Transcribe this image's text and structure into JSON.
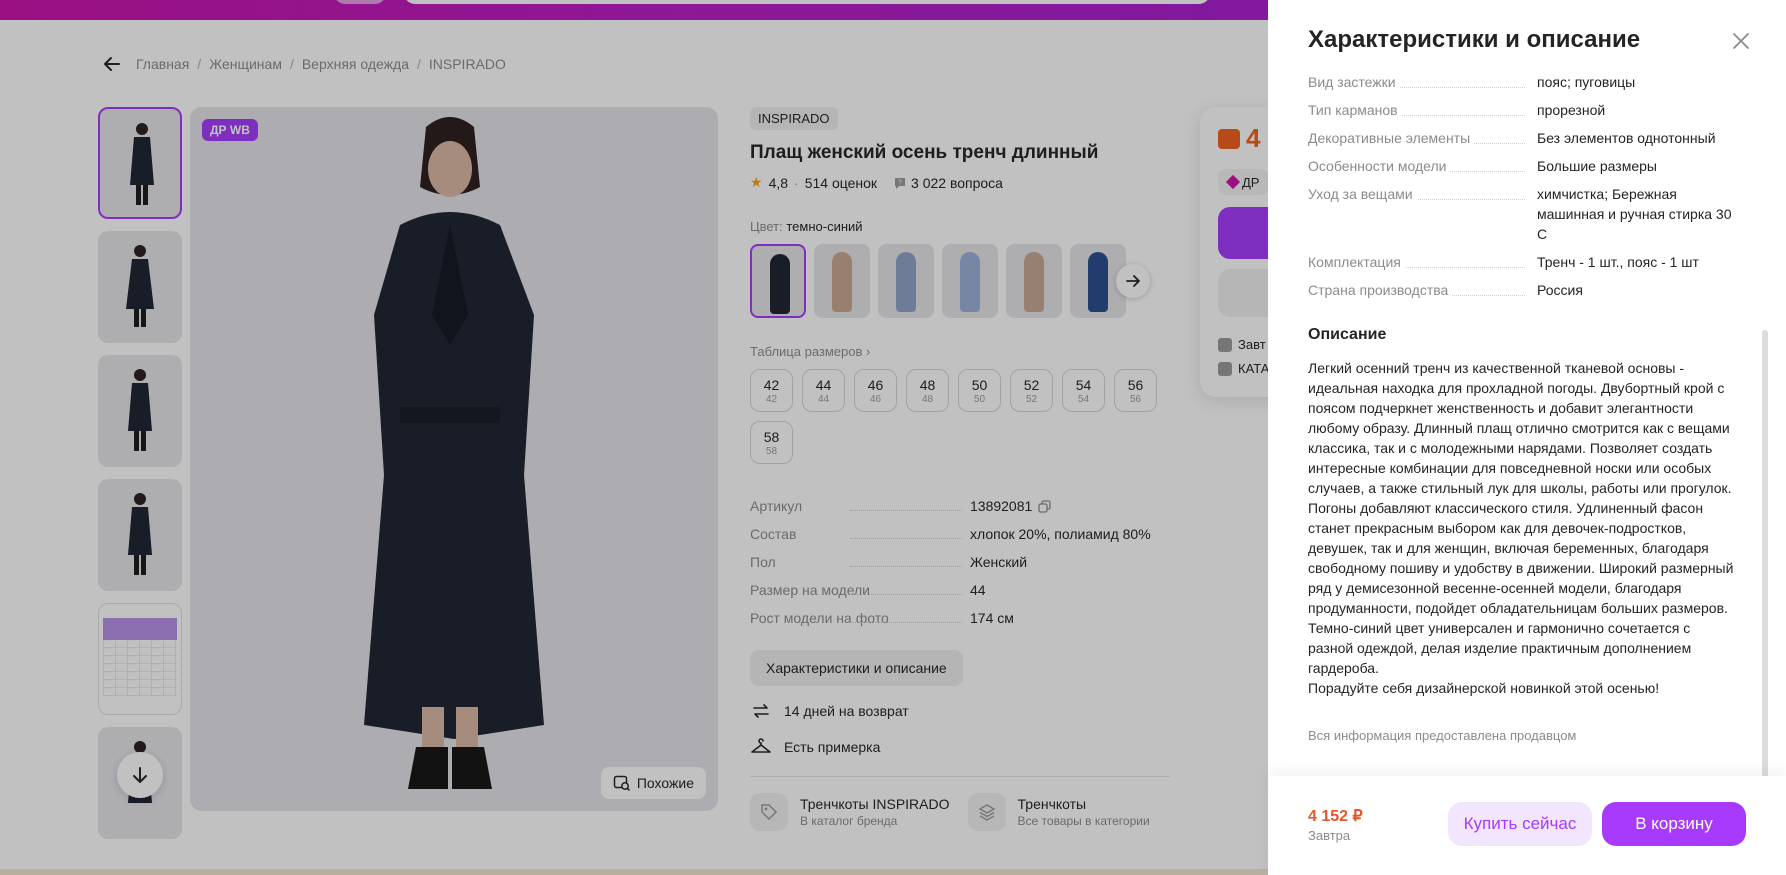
{
  "breadcrumbs": [
    "Главная",
    "Женщинам",
    "Верхняя одежда",
    "INSPIRADO"
  ],
  "gallery": {
    "badge": "ДР WB",
    "similar_label": "Похожие"
  },
  "product": {
    "brand": "INSPIRADO",
    "title": "Плащ женский осень тренч длинный",
    "rating": "4,8",
    "reviews": "514 оценок",
    "questions": "3 022 вопроса",
    "color_label": "Цвет:",
    "color_value": "темно-синий",
    "size_table_label": "Таблица размеров",
    "sizes": [
      {
        "ru": "42",
        "eu": "42"
      },
      {
        "ru": "44",
        "eu": "44"
      },
      {
        "ru": "46",
        "eu": "46"
      },
      {
        "ru": "48",
        "eu": "48"
      },
      {
        "ru": "50",
        "eu": "50"
      },
      {
        "ru": "52",
        "eu": "52"
      },
      {
        "ru": "54",
        "eu": "54"
      },
      {
        "ru": "56",
        "eu": "56"
      },
      {
        "ru": "58",
        "eu": "58"
      }
    ],
    "params": [
      {
        "k": "Артикул",
        "v": "13892081"
      },
      {
        "k": "Состав",
        "v": "хлопок 20%, полиамид 80%"
      },
      {
        "k": "Пол",
        "v": "Женский"
      },
      {
        "k": "Размер на модели",
        "v": "44"
      },
      {
        "k": "Рост модели на фото",
        "v": "174 см"
      }
    ],
    "char_button": "Характеристики и описание",
    "return_text": "14 дней на возврат",
    "fitting_text": "Есть примерка",
    "catalog_links": [
      {
        "title": "Тренчкоты INSPIRADO",
        "sub": "В каталог бренда"
      },
      {
        "title": "Тренчкоты",
        "sub": "Все товары в категории"
      }
    ]
  },
  "price_card": {
    "price_partial": "4",
    "dr_partial": "ДР",
    "line1": "Завт",
    "line2": "КАТА"
  },
  "drawer": {
    "title": "Характеристики и описание",
    "characteristics": [
      {
        "k": "Вид застежки",
        "v": "пояс; пуговицы"
      },
      {
        "k": "Тип карманов",
        "v": "прорезной"
      },
      {
        "k": "Декоративные элементы",
        "v": "Без элементов однотонный"
      },
      {
        "k": "Особенности модели",
        "v": "Большие размеры"
      },
      {
        "k": "Уход за вещами",
        "v": "химчистка; Бережная машинная и ручная стирка 30 С"
      },
      {
        "k": "Комплектация",
        "v": "Тренч - 1 шт., пояс - 1 шт"
      },
      {
        "k": "Страна производства",
        "v": "Россия"
      }
    ],
    "description_title": "Описание",
    "description": "Легкий осенний тренч из качественной тканевой основы - идеальная находка для прохладной погоды. Двубортный крой с поясом подчеркнет женственность и добавит элегантности любому образу. Длинный плащ отлично смотрится как с вещами классика, так и с молодежными нарядами. Позволяет создать интересные комбинации для повседневной носки или особых случаев, а также стильный лук для школы, работы или прогулок. Погоны добавляют классического стиля. Удлиненный фасон станет прекрасным выбором как для девочек-подростков, девушек, так и для женщин, включая беременных, благодаря свободному пошиву и удобству в движении. Широкий размерный ряд у демисезонной весенне-осенней модели, благодаря продуманности, подойдет обладательницам больших размеров.\nТемно-синий цвет универсален и гармонично сочетается с разной одеждой, делая изделие практичным дополнением гардероба.\nПорадуйте себя дизайнерской новинкой этой осенью!",
    "seller_note": "Вся информация предоставлена продавцом",
    "bottom": {
      "price": "4 152 ₽",
      "delivery": "Завтра",
      "buy_now": "Купить сейчас",
      "add_to_cart": "В корзину"
    }
  },
  "colors": {
    "accent": "#a73afd",
    "brand_pink": "#cb11ab",
    "price": "#e4572e",
    "coat": "#1c2230"
  }
}
